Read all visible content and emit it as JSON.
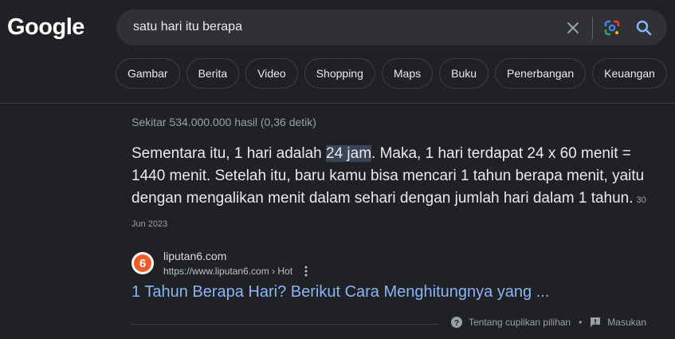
{
  "logo": {
    "text": "Google"
  },
  "search": {
    "query": "satu hari itu berapa",
    "icons": {
      "clear": "close-icon",
      "lens": "google-lens-icon",
      "search": "search-icon"
    }
  },
  "chips": [
    "Gambar",
    "Berita",
    "Video",
    "Shopping",
    "Maps",
    "Buku",
    "Penerbangan",
    "Keuangan"
  ],
  "result_stats": "Sekitar 534.000.000 hasil (0,36 detik)",
  "snippet": {
    "before": "Sementara itu, 1 hari adalah ",
    "highlight": "24 jam",
    "after": ". Maka, 1 hari terdapat 24 x 60 menit = 1440 menit. Setelah itu, baru kamu bisa mencari 1 tahun berapa menit, yaitu dengan mengalikan menit dalam sehari dengan jumlah hari dalam 1 tahun.",
    "date": "30 Jun 2023"
  },
  "source": {
    "favicon_text": "6",
    "site_name": "liputan6.com",
    "url": "https://www.liputan6.com › Hot"
  },
  "result_link": "1 Tahun Berapa Hari? Berikut Cara Menghitungnya yang ...",
  "footer": {
    "about": "Tentang cuplikan pilihan",
    "separator": "•",
    "feedback": "Masukan"
  },
  "colors": {
    "background": "#202124",
    "link": "#8ab4f8",
    "highlight": "#394457",
    "favicon": "#f15a24"
  }
}
